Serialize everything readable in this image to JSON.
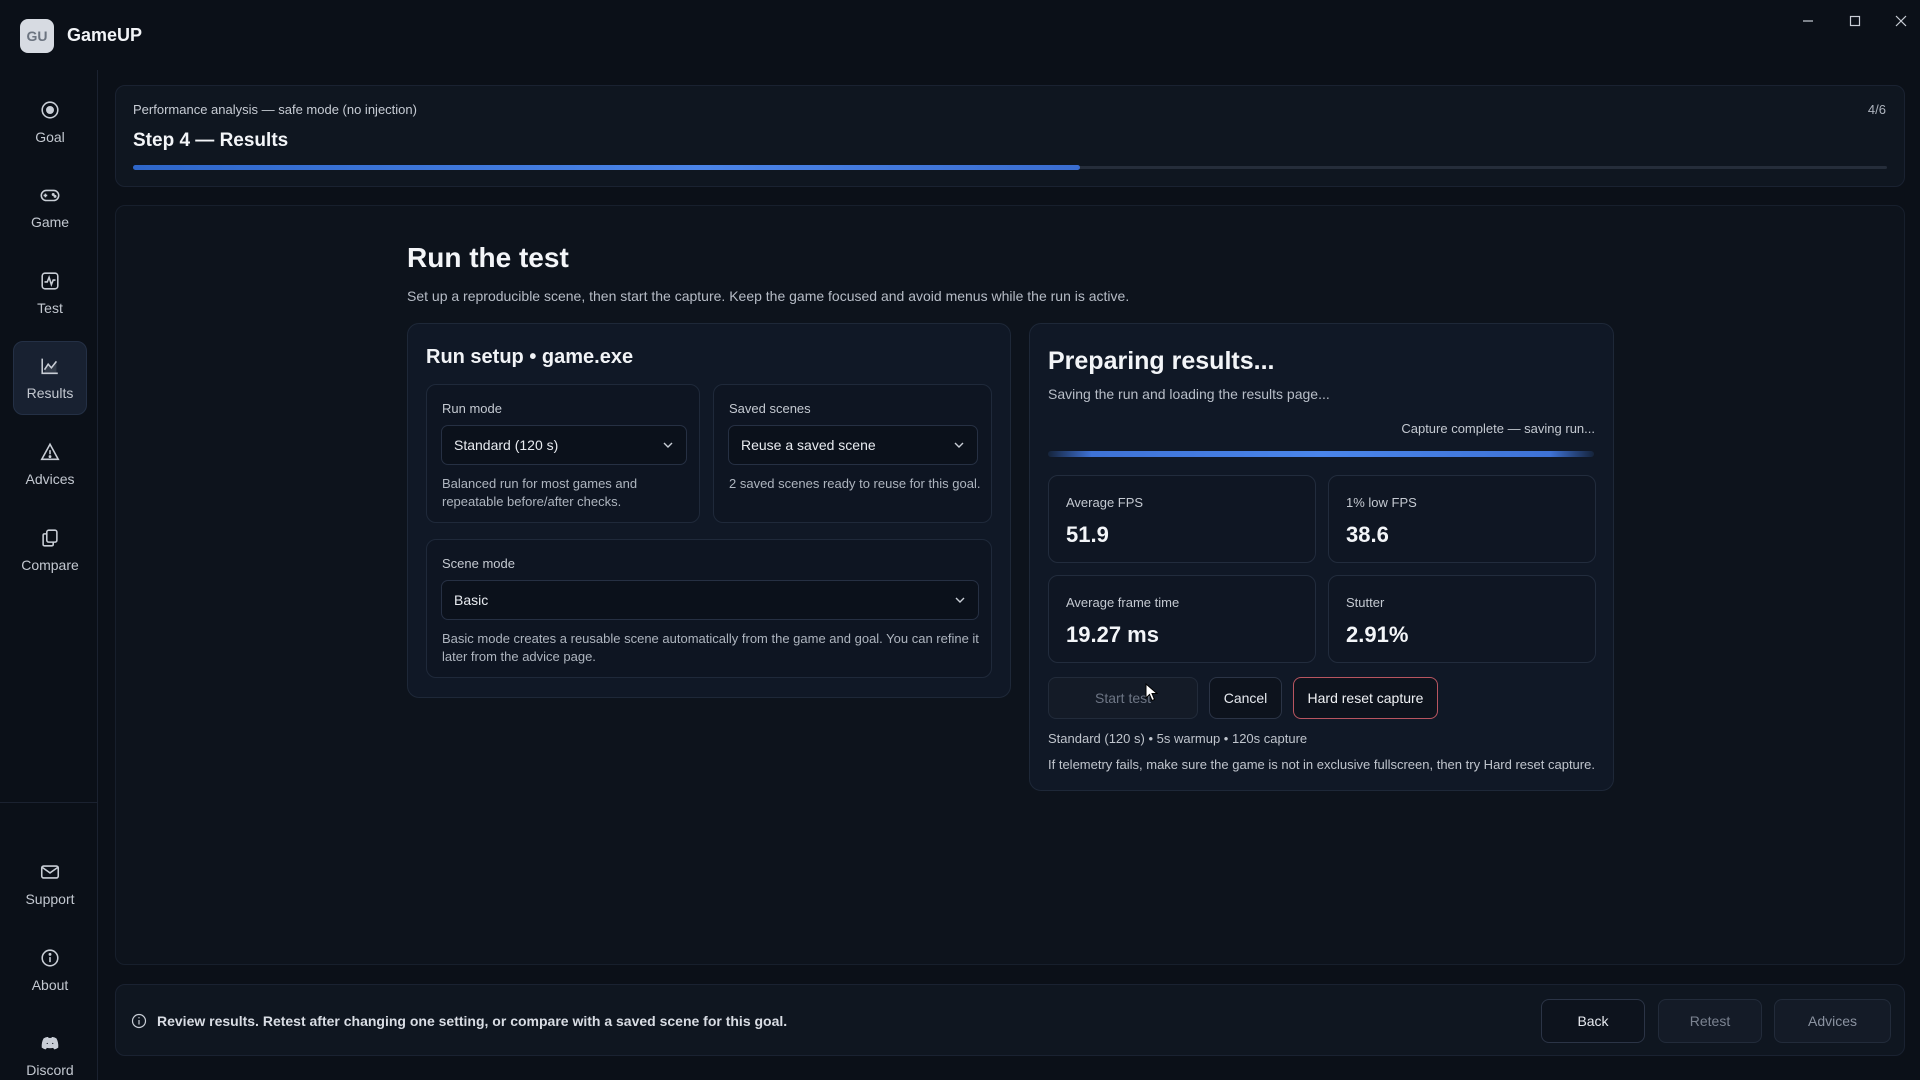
{
  "app": {
    "logo_text": "GU",
    "title": "GameUP"
  },
  "sidebar": {
    "items": [
      {
        "label": "Goal",
        "icon": "target-icon"
      },
      {
        "label": "Game",
        "icon": "gamepad-icon"
      },
      {
        "label": "Test",
        "icon": "activity-icon"
      },
      {
        "label": "Results",
        "icon": "chart-icon",
        "active": true
      },
      {
        "label": "Advices",
        "icon": "warning-icon"
      },
      {
        "label": "Compare",
        "icon": "copy-icon"
      }
    ],
    "bottom_items": [
      {
        "label": "Support",
        "icon": "mail-icon"
      },
      {
        "label": "About",
        "icon": "info-icon"
      },
      {
        "label": "Discord",
        "icon": "discord-icon"
      }
    ]
  },
  "header": {
    "subtitle": "Performance analysis — safe mode (no injection)",
    "step_counter": "4/6",
    "title": "Step 4 — Results",
    "progress_percent": 54
  },
  "main": {
    "title": "Run the test",
    "description": "Set up a reproducible scene, then start the capture. Keep the game focused and avoid menus while the run is active."
  },
  "run_setup": {
    "title": "Run setup • game.exe",
    "run_mode": {
      "label": "Run mode",
      "value": "Standard (120 s)",
      "helper_line1": "Balanced run for most games and",
      "helper_line2": "repeatable before/after checks."
    },
    "saved_scenes": {
      "label": "Saved scenes",
      "value": "Reuse a saved scene",
      "helper": "2 saved scenes ready to reuse for this goal."
    },
    "scene_mode": {
      "label": "Scene mode",
      "value": "Basic",
      "helper_line1": "Basic mode creates a reusable scene automatically from the game and goal. You can refine it",
      "helper_line2": "later from the advice page."
    }
  },
  "results": {
    "title": "Preparing results...",
    "description": "Saving the run and loading the results page...",
    "capture_status": "Capture complete — saving run...",
    "metrics": [
      {
        "label": "Average FPS",
        "value": "51.9"
      },
      {
        "label": "1% low FPS",
        "value": "38.6"
      },
      {
        "label": "Average frame time",
        "value": "19.27 ms"
      },
      {
        "label": "Stutter",
        "value": "2.91%"
      }
    ],
    "buttons": {
      "start": "Start test",
      "cancel": "Cancel",
      "hard_reset": "Hard reset capture"
    },
    "run_summary": "Standard (120 s) • 5s warmup • 120s capture",
    "telemetry_hint": "If telemetry fails, make sure the game is not in exclusive fullscreen, then try Hard reset capture."
  },
  "footer": {
    "message": "Review results. Retest after changing one setting, or compare with a saved scene for this goal.",
    "back": "Back",
    "retest": "Retest",
    "advices": "Advices"
  }
}
